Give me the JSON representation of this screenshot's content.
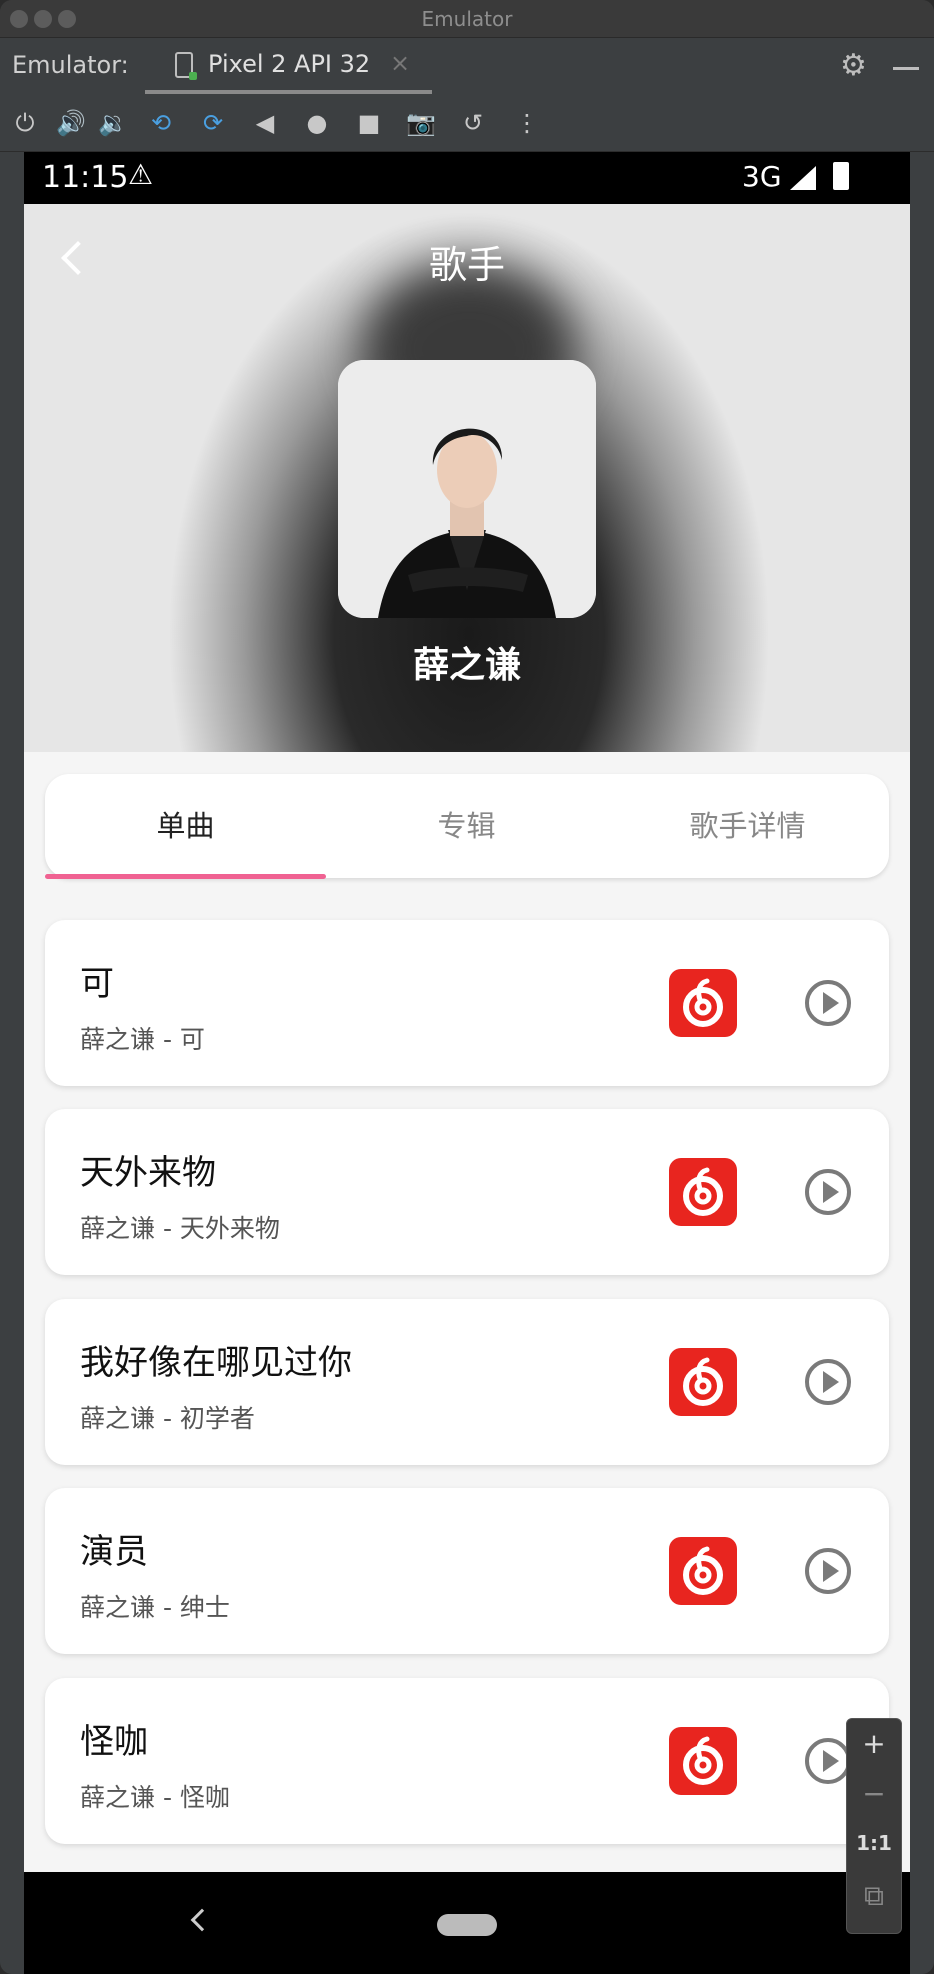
{
  "window": {
    "title": "Emulator"
  },
  "tabbar": {
    "label": "Emulator:",
    "device_tab": "Pixel 2 API 32",
    "close_glyph": "×",
    "settings_icon": "gear-icon"
  },
  "toolbar": {
    "icons": [
      "power-icon",
      "volume-up-icon",
      "volume-down-icon",
      "rotate-left-icon",
      "rotate-right-icon",
      "back-icon",
      "home-icon",
      "overview-icon",
      "camera-icon",
      "snapshot-icon",
      "more-icon"
    ]
  },
  "statusbar": {
    "time": "11:15",
    "network": "3G"
  },
  "header": {
    "title": "歌手",
    "artist_name": "薛之谦"
  },
  "tabs": [
    {
      "label": "单曲",
      "active": true
    },
    {
      "label": "专辑",
      "active": false
    },
    {
      "label": "歌手详情",
      "active": false
    }
  ],
  "songs": [
    {
      "title": "可",
      "subtitle": "薛之谦 - 可"
    },
    {
      "title": "天外来物",
      "subtitle": "薛之谦 - 天外来物"
    },
    {
      "title": "我好像在哪见过你",
      "subtitle": "薛之谦 - 初学者"
    },
    {
      "title": "演员",
      "subtitle": "薛之谦 - 绅士"
    },
    {
      "title": "怪咖",
      "subtitle": "薛之谦 - 怪咖"
    }
  ],
  "zoom": {
    "plus": "+",
    "minus": "−",
    "one_to_one": "1:1"
  },
  "colors": {
    "accent": "#f06292",
    "netease_red": "#e8251f",
    "page_bg": "#f5f5f5"
  }
}
